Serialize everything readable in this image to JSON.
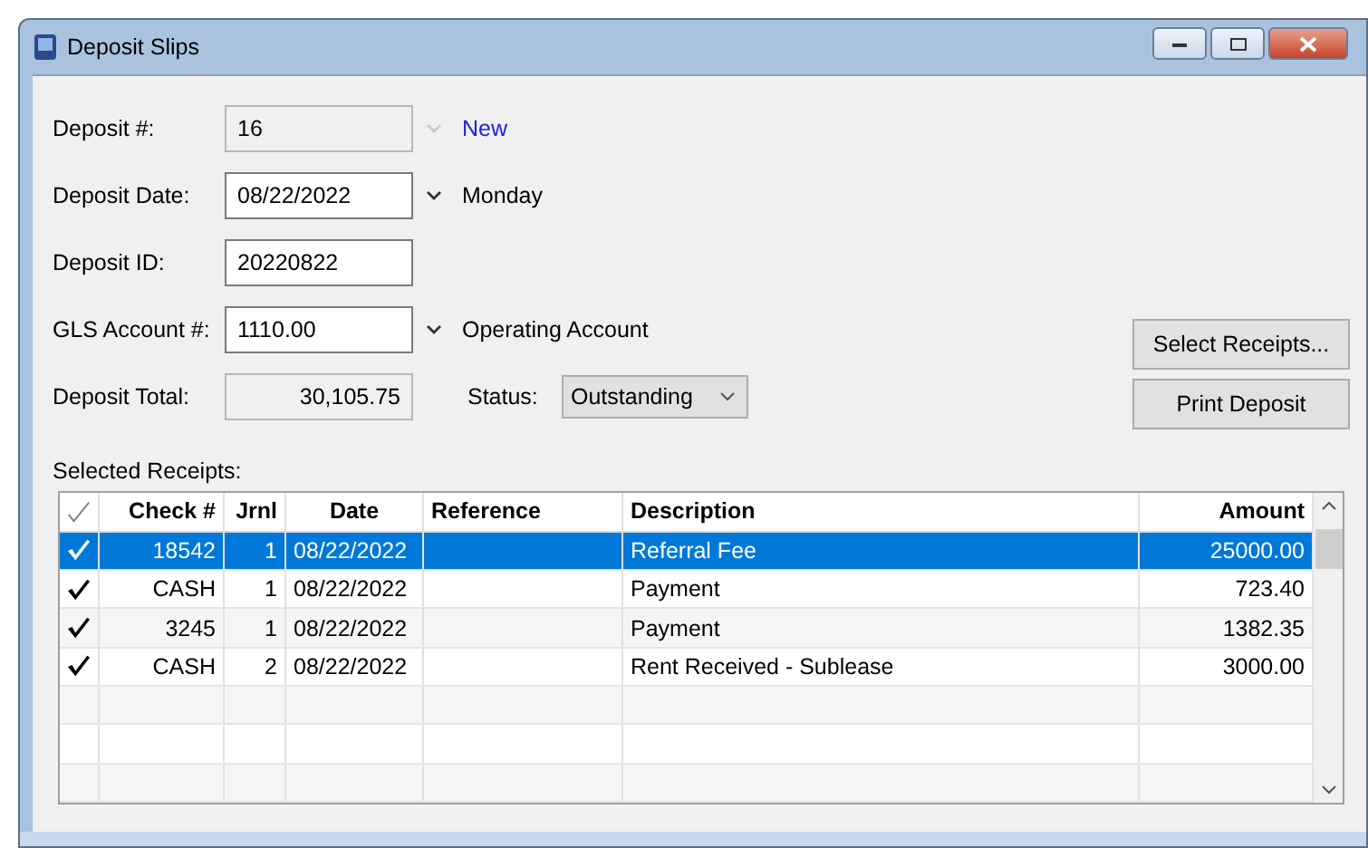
{
  "window": {
    "title": "Deposit Slips"
  },
  "form": {
    "deposit_number": {
      "label": "Deposit #:",
      "value": "16",
      "disabled": true,
      "link": "New"
    },
    "deposit_date": {
      "label": "Deposit Date:",
      "value": "08/22/2022",
      "note": "Monday"
    },
    "deposit_id": {
      "label": "Deposit ID:",
      "value": "20220822"
    },
    "gls_account": {
      "label": "GLS Account #:",
      "value": "1110.00",
      "note": "Operating Account"
    },
    "deposit_total": {
      "label": "Deposit Total:",
      "value": "30,105.75"
    },
    "status": {
      "label": "Status:",
      "value": "Outstanding"
    }
  },
  "buttons": [
    "Select Receipts...",
    "Print Deposit"
  ],
  "receipts": {
    "label": "Selected Receipts:",
    "columns": [
      "Check #",
      "Jrnl",
      "Date",
      "Reference",
      "Description",
      "Amount"
    ],
    "rows": [
      {
        "checked": true,
        "selected": true,
        "check_number": "18542",
        "jrnl": "1",
        "date": "08/22/2022",
        "description": "Referral Fee",
        "amount": "25000.00"
      },
      {
        "checked": true,
        "selected": false,
        "check_number": "CASH",
        "jrnl": "1",
        "date": "08/22/2022",
        "description": "Payment",
        "amount": "723.40"
      },
      {
        "checked": true,
        "selected": false,
        "check_number": "3245",
        "jrnl": "1",
        "date": "08/22/2022",
        "description": "Payment",
        "amount": "1382.35"
      },
      {
        "checked": true,
        "selected": false,
        "check_number": "CASH",
        "jrnl": "2",
        "date": "08/22/2022",
        "description": "Rent Received - Sublease",
        "amount": "3000.00"
      }
    ]
  }
}
